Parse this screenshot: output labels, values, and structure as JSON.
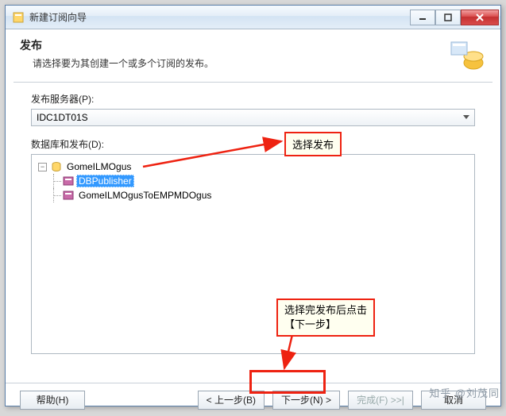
{
  "window": {
    "title": "新建订阅向导",
    "min_tip": "最小化",
    "max_tip": "最大化",
    "close_tip": "关闭"
  },
  "header": {
    "title": "发布",
    "subtitle": "请选择要为其创建一个或多个订阅的发布。"
  },
  "body": {
    "server_label": "发布服务器(P):",
    "server_value": "IDC1DT01S",
    "db_label": "数据库和发布(D):",
    "tree": {
      "root": "GomeILMOgus",
      "item_selected": "DBPublisher",
      "item2": "GomeILMOgusToEMPMDOgus"
    }
  },
  "footer": {
    "help": "帮助(H)",
    "back": "< 上一步(B)",
    "next": "下一步(N) >",
    "finish": "完成(F) >>|",
    "cancel": "取消"
  },
  "annotations": {
    "a1": "选择发布",
    "a2_line1": "选择完发布后点击",
    "a2_line2": "【下一步】"
  },
  "watermark": "知乎 @刘茂同"
}
